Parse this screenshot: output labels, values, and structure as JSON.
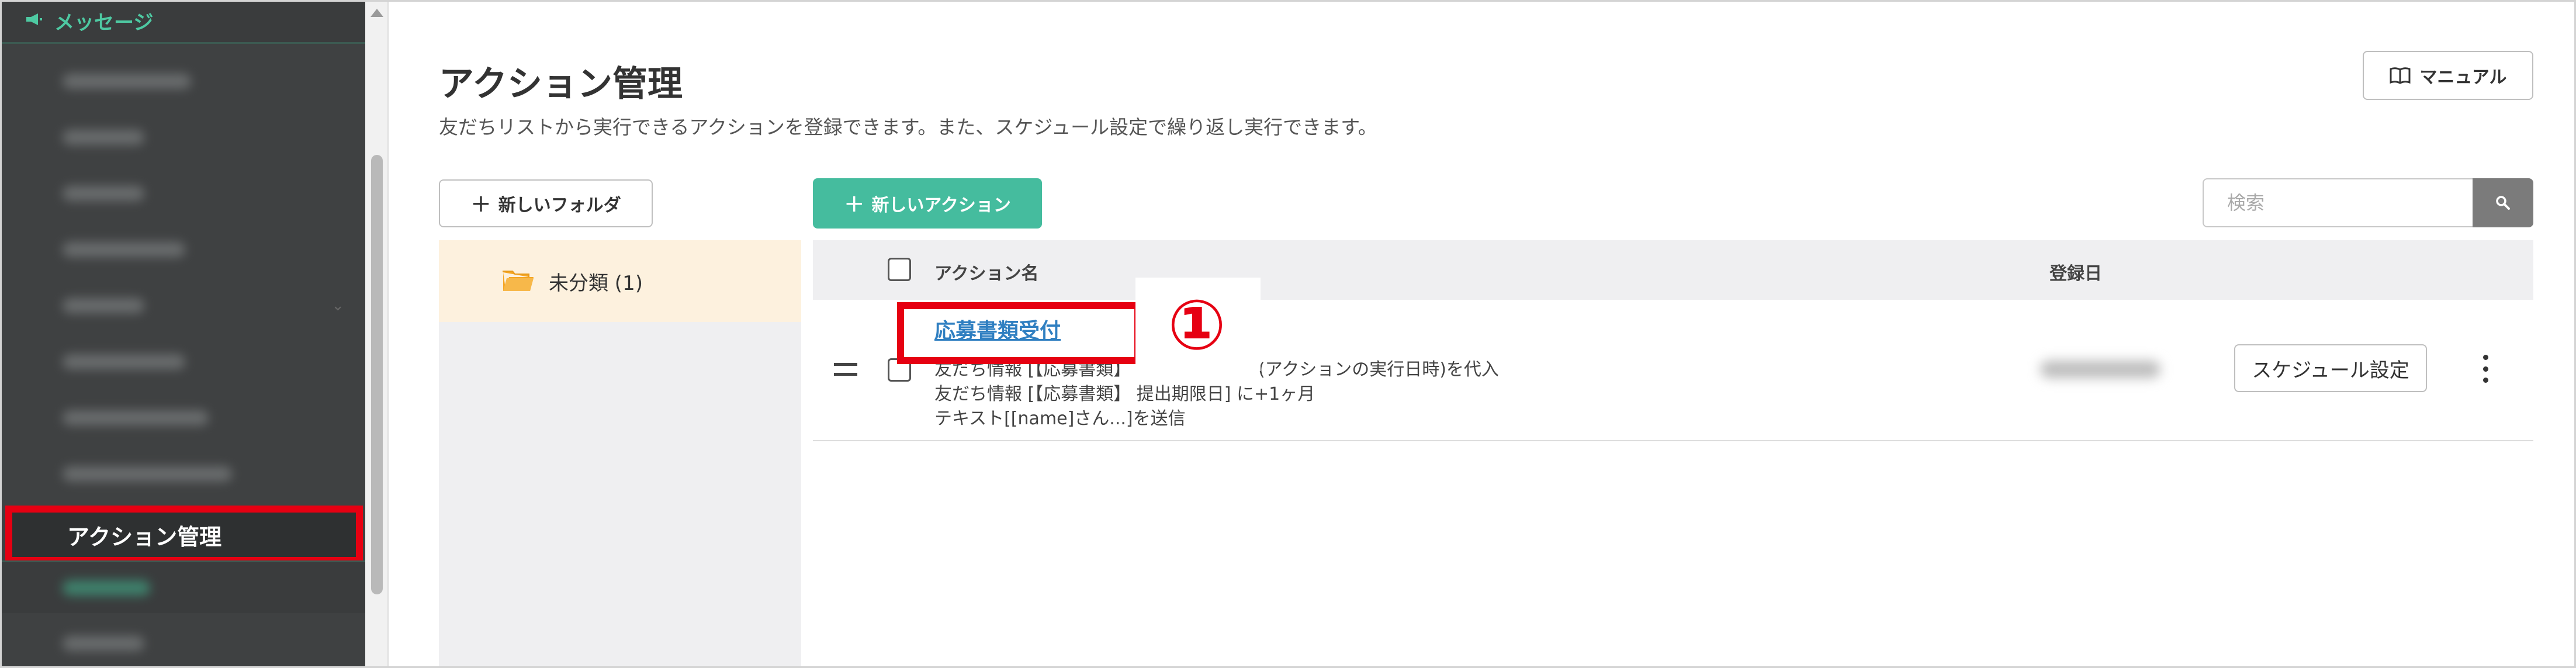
{
  "sidebar": {
    "section_label": "メッセージ",
    "section_icon": "megaphone-icon",
    "active_item_label": "アクション管理",
    "active_item_highlight_color": "#e60012",
    "accent_color": "#4ec9a2"
  },
  "header": {
    "title": "アクション管理",
    "description": "友だちリストから実行できるアクションを登録できます。また、スケジュール設定で繰り返し実行できます。",
    "manual_button_label": "マニュアル",
    "manual_icon": "book-icon"
  },
  "toolbar": {
    "new_folder_label": "新しいフォルダ",
    "new_action_label": "新しいアクション",
    "new_action_color": "#45bc9e",
    "search_placeholder": "検索",
    "search_icon": "search-icon"
  },
  "folders": [
    {
      "label": "未分類 (1)",
      "icon": "folder-icon",
      "selected": true
    }
  ],
  "table": {
    "columns": {
      "name": "アクション名",
      "date": "登録日"
    },
    "rows": [
      {
        "name": "応募書類受付",
        "details": [
          "友だち情報 [【応募書類】",
          "(アクションの実行日時)を代入",
          "友だち情報 [【応募書類】 提出期限日] に+1ヶ月",
          "テキスト[[name]さん...]を送信"
        ],
        "schedule_button_label": "スケジュール設定",
        "date_redacted": true
      }
    ]
  },
  "annotation": {
    "callout_label": "①",
    "color": "#e60012"
  }
}
